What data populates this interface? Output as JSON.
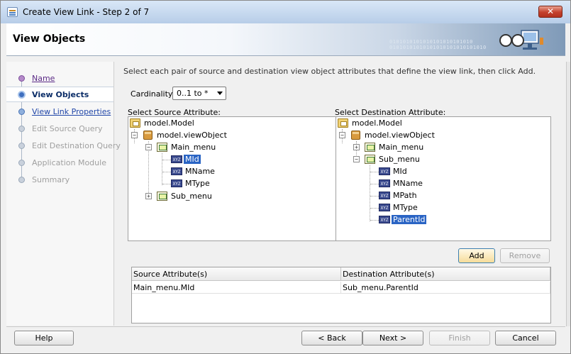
{
  "window": {
    "title": "Create View Link - Step 2 of 7",
    "close_glyph": "✕"
  },
  "header": {
    "title": "View Objects",
    "binary_text": "0101010101010101010101010 01010101010101010101010101010"
  },
  "nav": {
    "items": [
      {
        "label": "Name",
        "state": "visited"
      },
      {
        "label": "View Objects",
        "state": "current"
      },
      {
        "label": "View Link Properties",
        "state": "link"
      },
      {
        "label": "Edit Source Query",
        "state": "disabled"
      },
      {
        "label": "Edit Destination Query",
        "state": "disabled"
      },
      {
        "label": "Application Module",
        "state": "disabled"
      },
      {
        "label": "Summary",
        "state": "disabled"
      }
    ]
  },
  "main": {
    "instruction": "Select each pair of source and destination view object attributes that define the view link, then click Add.",
    "cardinality_label": "Cardinality:",
    "cardinality_value": "0..1 to *",
    "source_label": "Select Source Attribute:",
    "destination_label": "Select Destination Attribute:",
    "source_tree": {
      "root": "model.Model",
      "package": "model.viewObject",
      "vo1": "Main_menu",
      "vo1_attrs": [
        "MId",
        "MName",
        "MType"
      ],
      "vo2": "Sub_menu",
      "selected": "MId"
    },
    "destination_tree": {
      "root": "model.Model",
      "package": "model.viewObject",
      "vo1": "Main_menu",
      "vo2": "Sub_menu",
      "vo2_attrs": [
        "MId",
        "MName",
        "MPath",
        "MType",
        "ParentId"
      ],
      "selected": "ParentId"
    },
    "attr_badge": "XYZ",
    "add_label": "Add",
    "remove_label": "Remove",
    "table": {
      "headers": [
        "Source Attribute(s)",
        "Destination Attribute(s)"
      ],
      "rows": [
        [
          "Main_menu.MId",
          "Sub_menu.ParentId"
        ]
      ]
    }
  },
  "footer": {
    "help_label": "Help",
    "back_label": "< Back",
    "next_label": "Next >",
    "finish_label": "Finish",
    "cancel_label": "Cancel"
  },
  "colors": {
    "selection": "#2a64c4",
    "link": "#2046a8",
    "visited": "#5b2a86",
    "close": "#c4412c"
  }
}
